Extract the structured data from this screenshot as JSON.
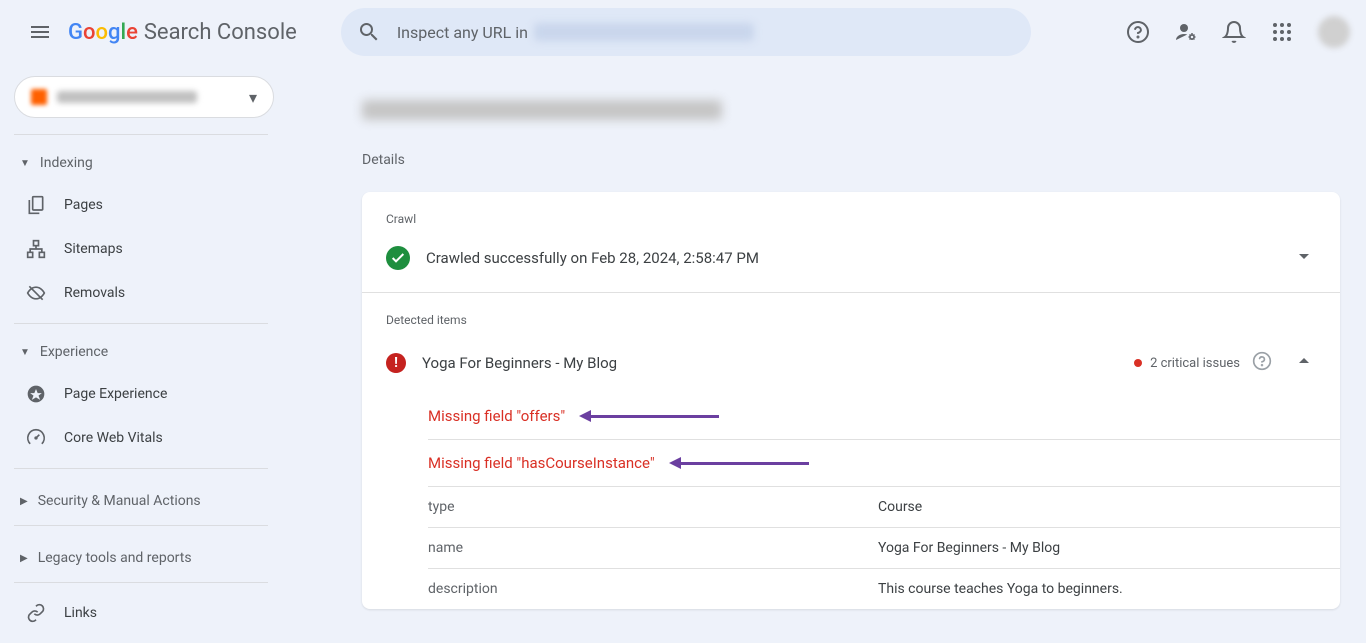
{
  "header": {
    "logo_sc": "Search Console",
    "search_prefix": "Inspect any URL in"
  },
  "sidebar": {
    "sections": {
      "indexing": "Indexing",
      "experience": "Experience",
      "security": "Security & Manual Actions",
      "legacy": "Legacy tools and reports",
      "links": "Links"
    },
    "items": {
      "pages": "Pages",
      "sitemaps": "Sitemaps",
      "removals": "Removals",
      "page_experience": "Page Experience",
      "core_web_vitals": "Core Web Vitals"
    }
  },
  "details": {
    "label": "Details",
    "crawl_label": "Crawl",
    "crawl_status": "Crawled successfully on Feb 28, 2024, 2:58:47 PM",
    "detected_label": "Detected items",
    "item_title": "Yoga For Beginners - My Blog",
    "issue_count": "2 critical issues",
    "issues": [
      "Missing field \"offers\"",
      "Missing field \"hasCourseInstance\""
    ],
    "props": [
      {
        "key": "type",
        "value": "Course"
      },
      {
        "key": "name",
        "value": "Yoga For Beginners - My Blog"
      },
      {
        "key": "description",
        "value": "This course teaches Yoga to beginners."
      }
    ]
  }
}
